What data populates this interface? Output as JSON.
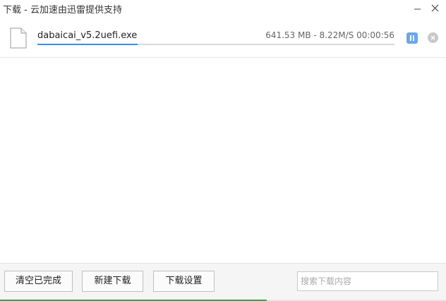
{
  "window": {
    "title": "下载 - 云加速由迅雷提供支持"
  },
  "download": {
    "file_name": "dabaicai_v5.2uefi.exe",
    "status": "641.53 MB - 8.22M/S 00:00:56",
    "progress_fraction": 0.28,
    "icons": {
      "file": "file-icon",
      "pause": "pause-icon",
      "cancel": "close-circle-icon"
    }
  },
  "footer": {
    "clear_label": "清空已完成",
    "new_label": "新建下载",
    "settings_label": "下载设置",
    "search_placeholder": "搜索下载内容",
    "search_value": ""
  },
  "colors": {
    "accent": "#3a8ee6",
    "pause_button": "#6aa7ec",
    "bottom_strip_accent": "#2fa84a"
  }
}
